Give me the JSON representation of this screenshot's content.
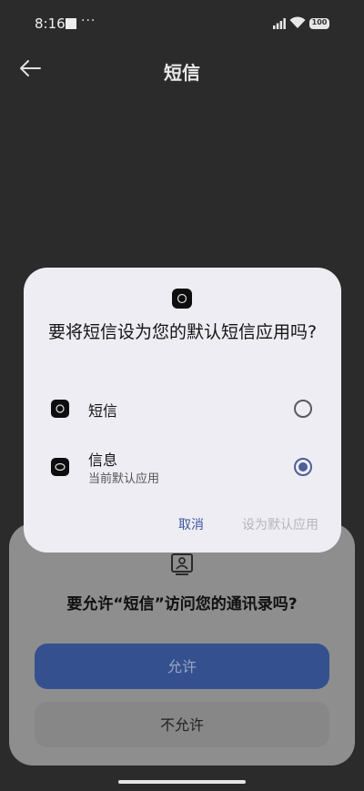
{
  "status_bar": {
    "time": "8:16",
    "notification_dots": "···",
    "battery": "100"
  },
  "header": {
    "title": "短信",
    "back_icon": "arrow-left-icon"
  },
  "permission_sheet": {
    "icon": "contacts-icon",
    "title": "要允许“短信”访问您的通讯录吗?",
    "allow_label": "允许",
    "deny_label": "不允许"
  },
  "dialog": {
    "title": "要将短信设为您的默认短信应用吗?",
    "options": [
      {
        "label": "短信",
        "subtitle": "",
        "selected": false
      },
      {
        "label": "信息",
        "subtitle": "当前默认应用",
        "selected": true
      }
    ],
    "cancel_label": "取消",
    "set_default_label": "设为默认应用"
  },
  "colors": {
    "accent": "#4c5f96",
    "dialog_bg": "#eeedf3",
    "allow_button": "#34508f"
  }
}
